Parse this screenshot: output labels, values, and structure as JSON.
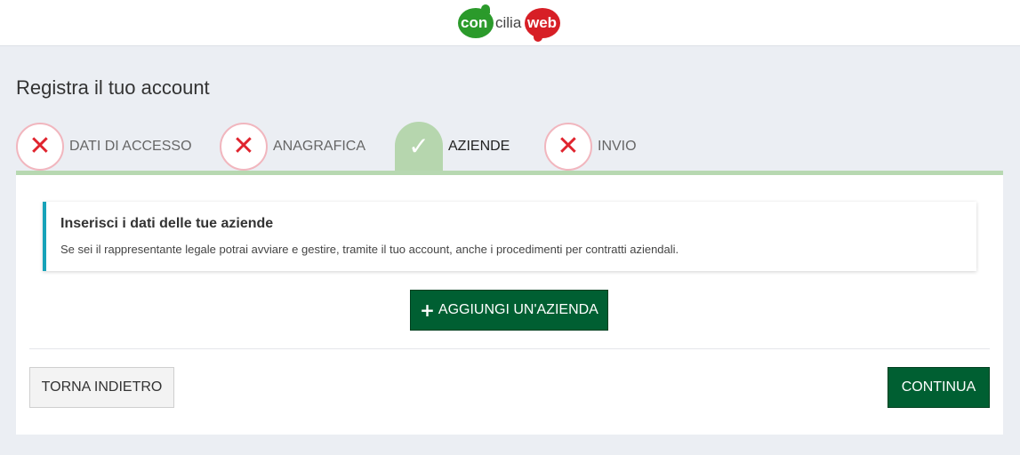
{
  "header": {
    "logo": {
      "part1": "con",
      "part2": "cilia",
      "part3": "web",
      "green": "#2b9a2b",
      "red": "#d71f26"
    }
  },
  "page_title": "Registra il tuo account",
  "steps": [
    {
      "label": "DATI DI ACCESSO",
      "status": "error",
      "icon": "close-icon"
    },
    {
      "label": "ANAGRAFICA",
      "status": "error",
      "icon": "close-icon"
    },
    {
      "label": "AZIENDE",
      "status": "active",
      "icon": "check-icon"
    },
    {
      "label": "INVIO",
      "status": "error",
      "icon": "close-icon"
    }
  ],
  "info": {
    "title": "Inserisci i dati delle tue aziende",
    "text": "Se sei il rappresentante legale potrai avviare e gestire, tramite il tuo account, anche i procedimenti per contratti aziendali."
  },
  "buttons": {
    "add_company": "AGGIUNGI UN'AZIENDA",
    "back": "TORNA INDIETRO",
    "continue": "CONTINUA"
  },
  "colors": {
    "primary_green": "#005f32",
    "step_active": "#b6d6ae",
    "error_red": "#e0242e",
    "info_accent": "#17a2b8"
  }
}
